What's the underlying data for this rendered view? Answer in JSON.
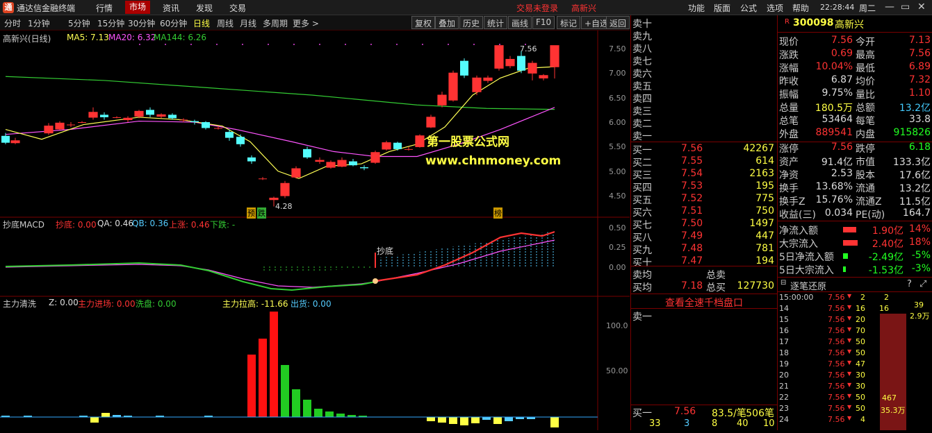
{
  "titlebar": {
    "app_name": "通达信金融终端",
    "menus": [
      "行情",
      "市场",
      "资讯",
      "发现",
      "交易"
    ],
    "active_menu": "市场",
    "login_status": "交易未登录",
    "stock_name": "高新兴",
    "right_menus": [
      "功能",
      "版面",
      "公式",
      "选项",
      "帮助"
    ],
    "time": "22:28:44",
    "weekday": "周二"
  },
  "toolbar": {
    "periods": [
      "分时",
      "1分钟",
      "5分钟",
      "15分钟",
      "30分钟",
      "60分钟",
      "日线",
      "周线",
      "月线",
      "多周期",
      "更多 >"
    ],
    "selected": "日线",
    "buttons": [
      "复权",
      "叠加",
      "历史",
      "统计",
      "画线",
      "F10",
      "标记",
      "+自选",
      "返回"
    ]
  },
  "chart_main": {
    "title": "高新兴(日线)",
    "ma5": "MA5: 7.13",
    "ma20": "MA20: 6.32",
    "ma144": "MA144: 6.26",
    "high_label": "7.56",
    "low_label": "4.28",
    "tag_yu": "预",
    "tag_die": "跌",
    "tag_bang": "榜",
    "watermark_1": "第一股票公式网",
    "watermark_2": "www.chnmoney.com",
    "y_ticks": [
      "7.50",
      "7.00",
      "6.50",
      "6.00",
      "5.50",
      "5.00",
      "4.50"
    ]
  },
  "chart_macd": {
    "title": "抄底MACD",
    "chaodi": "抄底: 0.00",
    "qa": "QA: 0.46",
    "qb": "QB: 0.36",
    "up": "上涨: 0.46",
    "down": "下跌: -",
    "signal": "抄底",
    "y_ticks": [
      "0.50",
      "0.25",
      "0.00"
    ]
  },
  "chart_flow": {
    "title": "主力清洗",
    "z": "Z: 0.00",
    "enter": "主力进场: 0.00",
    "wash": "洗盘: 0.00",
    "lift": "主力拉高: -11.66",
    "out": "出货: 0.00",
    "y_ticks": [
      "100.0",
      "50.00"
    ]
  },
  "orderbook": {
    "sell_labels": [
      "卖十",
      "卖九",
      "卖八",
      "卖七",
      "卖六",
      "卖五",
      "卖四",
      "卖三",
      "卖二",
      "卖一"
    ],
    "buy": [
      {
        "label": "买一",
        "price": "7.56",
        "vol": "42267"
      },
      {
        "label": "买二",
        "price": "7.55",
        "vol": "614"
      },
      {
        "label": "买三",
        "price": "7.54",
        "vol": "2163"
      },
      {
        "label": "买四",
        "price": "7.53",
        "vol": "195"
      },
      {
        "label": "买五",
        "price": "7.52",
        "vol": "775"
      },
      {
        "label": "买六",
        "price": "7.51",
        "vol": "750"
      },
      {
        "label": "买七",
        "price": "7.50",
        "vol": "1497"
      },
      {
        "label": "买八",
        "price": "7.49",
        "vol": "447"
      },
      {
        "label": "买九",
        "price": "7.48",
        "vol": "781"
      },
      {
        "label": "买十",
        "price": "7.47",
        "vol": "194"
      }
    ],
    "sell_avg_label": "卖均",
    "total_sell_label": "总卖",
    "buy_avg_label": "买均",
    "buy_avg": "7.18",
    "total_buy_label": "总买",
    "total_buy": "127730",
    "link": "查看全速千档盘口",
    "sell1_label": "卖一",
    "bottom_buy1": {
      "label": "买一",
      "price": "7.56",
      "per": "83.5/笔",
      "count": "506笔"
    },
    "bottom_row": [
      "33",
      "3",
      "8",
      "40",
      "10"
    ]
  },
  "quote": {
    "code": "300098",
    "name": "高新兴",
    "rows": [
      [
        {
          "k": "现价",
          "v": "7.56",
          "c": "#f33"
        },
        {
          "k": "今开",
          "v": "7.13",
          "c": "#f33"
        }
      ],
      [
        {
          "k": "涨跌",
          "v": "0.69",
          "c": "#f33"
        },
        {
          "k": "最高",
          "v": "7.56",
          "c": "#f33"
        }
      ],
      [
        {
          "k": "涨幅",
          "v": "10.04%",
          "c": "#f33"
        },
        {
          "k": "最低",
          "v": "6.89",
          "c": "#f33"
        }
      ],
      [
        {
          "k": "昨收",
          "v": "6.87",
          "c": "#ddd"
        },
        {
          "k": "均价",
          "v": "7.32",
          "c": "#f33"
        }
      ],
      [
        {
          "k": "振幅",
          "v": "9.75%",
          "c": "#ddd"
        },
        {
          "k": "量比",
          "v": "1.10",
          "c": "#f33"
        }
      ],
      [
        {
          "k": "总量",
          "v": "180.5万",
          "c": "#ff4"
        },
        {
          "k": "总额",
          "v": "13.2亿",
          "c": "#4cf"
        }
      ],
      [
        {
          "k": "总笔",
          "v": "53464",
          "c": "#ddd"
        },
        {
          "k": "每笔",
          "v": "33.8",
          "c": "#ddd"
        }
      ],
      [
        {
          "k": "外盘",
          "v": "889541",
          "c": "#f33"
        },
        {
          "k": "内盘",
          "v": "915826",
          "c": "#2f2"
        }
      ],
      [
        {
          "k": "涨停",
          "v": "7.56",
          "c": "#f33"
        },
        {
          "k": "跌停",
          "v": "6.18",
          "c": "#2f2"
        }
      ],
      [
        {
          "k": "资产",
          "v": "91.4亿",
          "c": "#ddd"
        },
        {
          "k": "市值",
          "v": "133.3亿",
          "c": "#ddd"
        }
      ],
      [
        {
          "k": "净资",
          "v": "2.53",
          "c": "#ddd"
        },
        {
          "k": "股本",
          "v": "17.6亿",
          "c": "#ddd"
        }
      ],
      [
        {
          "k": "换手",
          "v": "13.68%",
          "c": "#ddd"
        },
        {
          "k": "流通",
          "v": "13.2亿",
          "c": "#ddd"
        }
      ],
      [
        {
          "k": "换手Z",
          "v": "15.76%",
          "c": "#ddd"
        },
        {
          "k": "流通Z",
          "v": "11.5亿",
          "c": "#ddd"
        }
      ],
      [
        {
          "k": "收益(三)",
          "v": "0.034",
          "c": "#ddd"
        },
        {
          "k": "PE(动)",
          "v": "164.7",
          "c": "#ddd"
        }
      ]
    ],
    "flows": [
      {
        "k": "净流入额",
        "v": "1.90亿",
        "p": "14%",
        "c": "#f33",
        "bar": 0.85
      },
      {
        "k": "大宗流入",
        "v": "2.40亿",
        "p": "18%",
        "c": "#f33",
        "bar": 0.95
      },
      {
        "k": "5日净流入额",
        "v": "-2.49亿",
        "p": "-5%",
        "c": "#2f2",
        "bar": 0.3
      },
      {
        "k": "5日大宗流入",
        "v": "-1.53亿",
        "p": "-3%",
        "c": "#2f2",
        "bar": 0.2
      }
    ],
    "ticks_title": "逐笔还原",
    "ticks": [
      {
        "t": "15:00:00",
        "p": "7.56",
        "a": "2",
        "b": "2"
      },
      {
        "t": "14",
        "p": "7.56",
        "a": "16",
        "b": "16"
      },
      {
        "t": "15",
        "p": "7.56",
        "a": "20",
        "b": ""
      },
      {
        "t": "16",
        "p": "7.56",
        "a": "70",
        "b": ""
      },
      {
        "t": "17",
        "p": "7.56",
        "a": "50",
        "b": ""
      },
      {
        "t": "18",
        "p": "7.56",
        "a": "50",
        "b": ""
      },
      {
        "t": "19",
        "p": "7.56",
        "a": "47",
        "b": ""
      },
      {
        "t": "20",
        "p": "7.56",
        "a": "30",
        "b": ""
      },
      {
        "t": "21",
        "p": "7.56",
        "a": "30",
        "b": ""
      },
      {
        "t": "22",
        "p": "7.56",
        "a": "50",
        "b": ""
      },
      {
        "t": "23",
        "p": "7.56",
        "a": "50",
        "b": ""
      },
      {
        "t": "24",
        "p": "7.56",
        "a": "4",
        "b": ""
      }
    ],
    "tick_side": [
      "39",
      "2.9万"
    ],
    "tick_big": [
      "467",
      "35.3万"
    ],
    "tick_side_right": [
      "1",
      "1",
      "1",
      "1",
      "1",
      "1",
      "1",
      "1",
      "1",
      "1"
    ]
  },
  "colors": {
    "up": "#ff3333",
    "down": "#54fcfc",
    "ma5": "#ffff55",
    "ma20": "#ff55ff",
    "ma144": "#33cc33"
  }
}
